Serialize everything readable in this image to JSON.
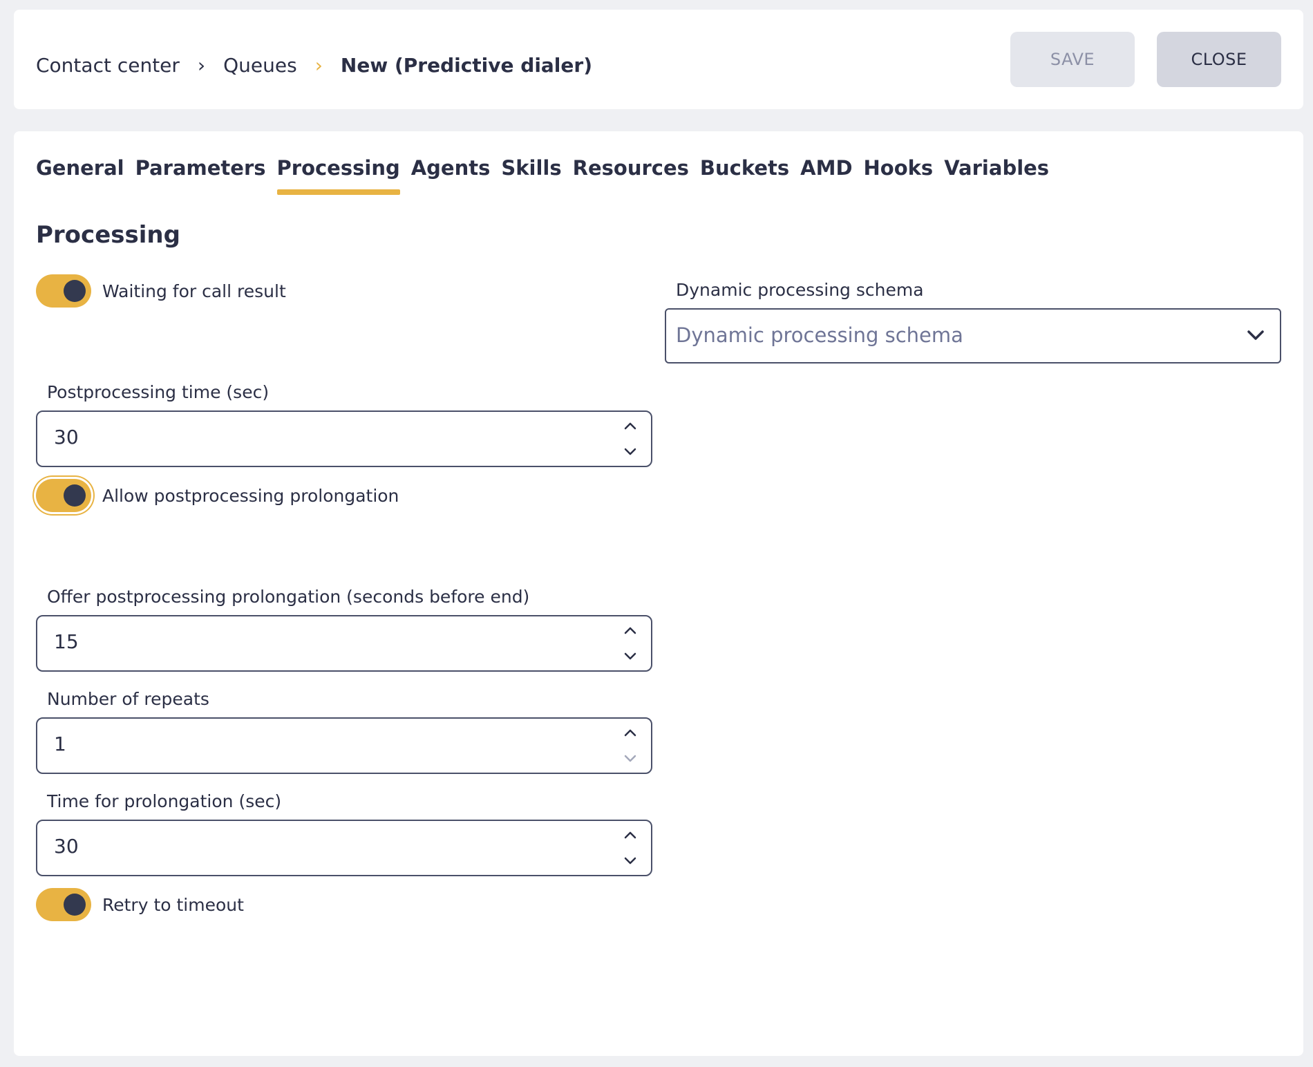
{
  "breadcrumb": {
    "items": [
      "Contact center",
      "Queues"
    ],
    "current": "New (Predictive dialer)",
    "separator": "›"
  },
  "header": {
    "save_label": "SAVE",
    "close_label": "CLOSE"
  },
  "tabs": [
    {
      "label": "General",
      "active": false
    },
    {
      "label": "Parameters",
      "active": false
    },
    {
      "label": "Processing",
      "active": true
    },
    {
      "label": "Agents",
      "active": false
    },
    {
      "label": "Skills",
      "active": false
    },
    {
      "label": "Resources",
      "active": false
    },
    {
      "label": "Buckets",
      "active": false
    },
    {
      "label": "AMD",
      "active": false
    },
    {
      "label": "Hooks",
      "active": false
    },
    {
      "label": "Variables",
      "active": false
    }
  ],
  "section": {
    "title": "Processing"
  },
  "toggles": {
    "waiting_for_call_result": {
      "label": "Waiting for call result",
      "checked": true
    },
    "allow_postprocessing_prolongation": {
      "label": "Allow postprocessing prolongation",
      "checked": true
    },
    "retry_to_timeout": {
      "label": "Retry to timeout",
      "checked": true
    }
  },
  "fields": {
    "postprocessing_time": {
      "label": "Postprocessing time (sec)",
      "value": "30"
    },
    "offer_prolongation": {
      "label": "Offer postprocessing prolongation (seconds before end)",
      "value": "15"
    },
    "number_of_repeats": {
      "label": "Number of repeats",
      "value": "1"
    },
    "time_for_prolongation": {
      "label": "Time for prolongation (sec)",
      "value": "30"
    }
  },
  "dynamic_schema": {
    "label": "Dynamic processing schema",
    "placeholder": "Dynamic processing schema"
  },
  "colors": {
    "accent": "#e8b343",
    "text": "#2b2f45",
    "knob": "#33394f",
    "background": "#eff0f3"
  },
  "icons": {
    "spin_up": "chevron-up-icon",
    "spin_down": "chevron-down-icon",
    "select": "chevron-down-icon"
  }
}
